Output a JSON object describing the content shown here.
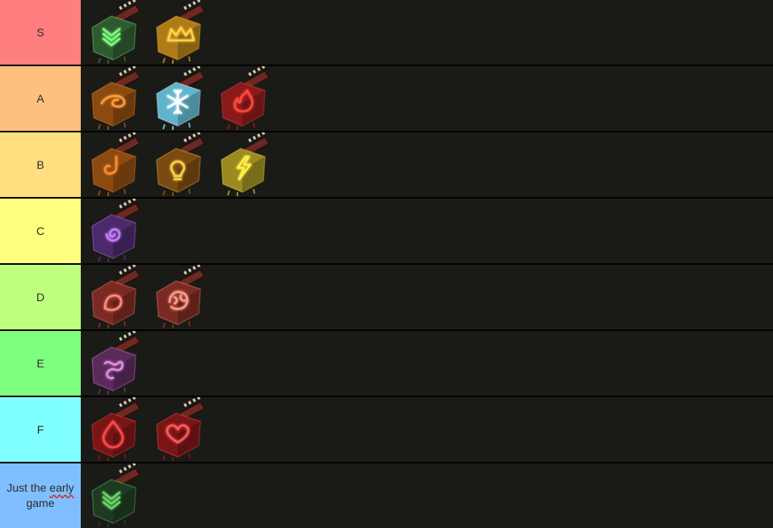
{
  "tiers": [
    {
      "label": "S",
      "color": "#ff7f7f",
      "items": [
        {
          "icon": "chevron-stripes-icon",
          "fill": "#2f5a2f",
          "glow": "#7dff7d"
        },
        {
          "icon": "crown-icon",
          "fill": "#b07a16",
          "glow": "#ffd34a"
        }
      ]
    },
    {
      "label": "A",
      "color": "#ffbf7f",
      "items": [
        {
          "icon": "swirl-icon",
          "fill": "#8a4a10",
          "glow": "#ff9a3a"
        },
        {
          "icon": "snowflake-icon",
          "fill": "#5fb4cc",
          "glow": "#ffffff"
        },
        {
          "icon": "flame-icon",
          "fill": "#8a1a1a",
          "glow": "#ff4a3a"
        }
      ]
    },
    {
      "label": "B",
      "color": "#ffdf7f",
      "items": [
        {
          "icon": "hook-icon",
          "fill": "#8a4a10",
          "glow": "#ff8a30"
        },
        {
          "icon": "lightbulb-icon",
          "fill": "#7a4a10",
          "glow": "#ffd24a"
        },
        {
          "icon": "lightning-icon",
          "fill": "#9a8a20",
          "glow": "#fff04a"
        }
      ]
    },
    {
      "label": "C",
      "color": "#ffff7f",
      "items": [
        {
          "icon": "spiral-icon",
          "fill": "#4a2a6a",
          "glow": "#c77dff"
        }
      ]
    },
    {
      "label": "D",
      "color": "#bfff7f",
      "items": [
        {
          "icon": "fist-icon",
          "fill": "#7a2a22",
          "glow": "#ff8a7a"
        },
        {
          "icon": "brain-icon",
          "fill": "#7a2a22",
          "glow": "#ff9a8a"
        }
      ]
    },
    {
      "label": "E",
      "color": "#7fff7f",
      "items": [
        {
          "icon": "squiggle-icon",
          "fill": "#5a2a5a",
          "glow": "#e08ae0"
        }
      ]
    },
    {
      "label": "F",
      "color": "#7fffff",
      "items": [
        {
          "icon": "drop-icon",
          "fill": "#7a1515",
          "glow": "#ff4a4a"
        },
        {
          "icon": "heart-icon",
          "fill": "#7a1515",
          "glow": "#ff5a5a"
        }
      ]
    },
    {
      "label_parts": [
        "Just the ",
        "early",
        " game"
      ],
      "color": "#7fbfff",
      "items": [
        {
          "icon": "chevron-stripes-icon",
          "fill": "#1f3a22",
          "glow": "#6ad66a"
        }
      ]
    }
  ]
}
